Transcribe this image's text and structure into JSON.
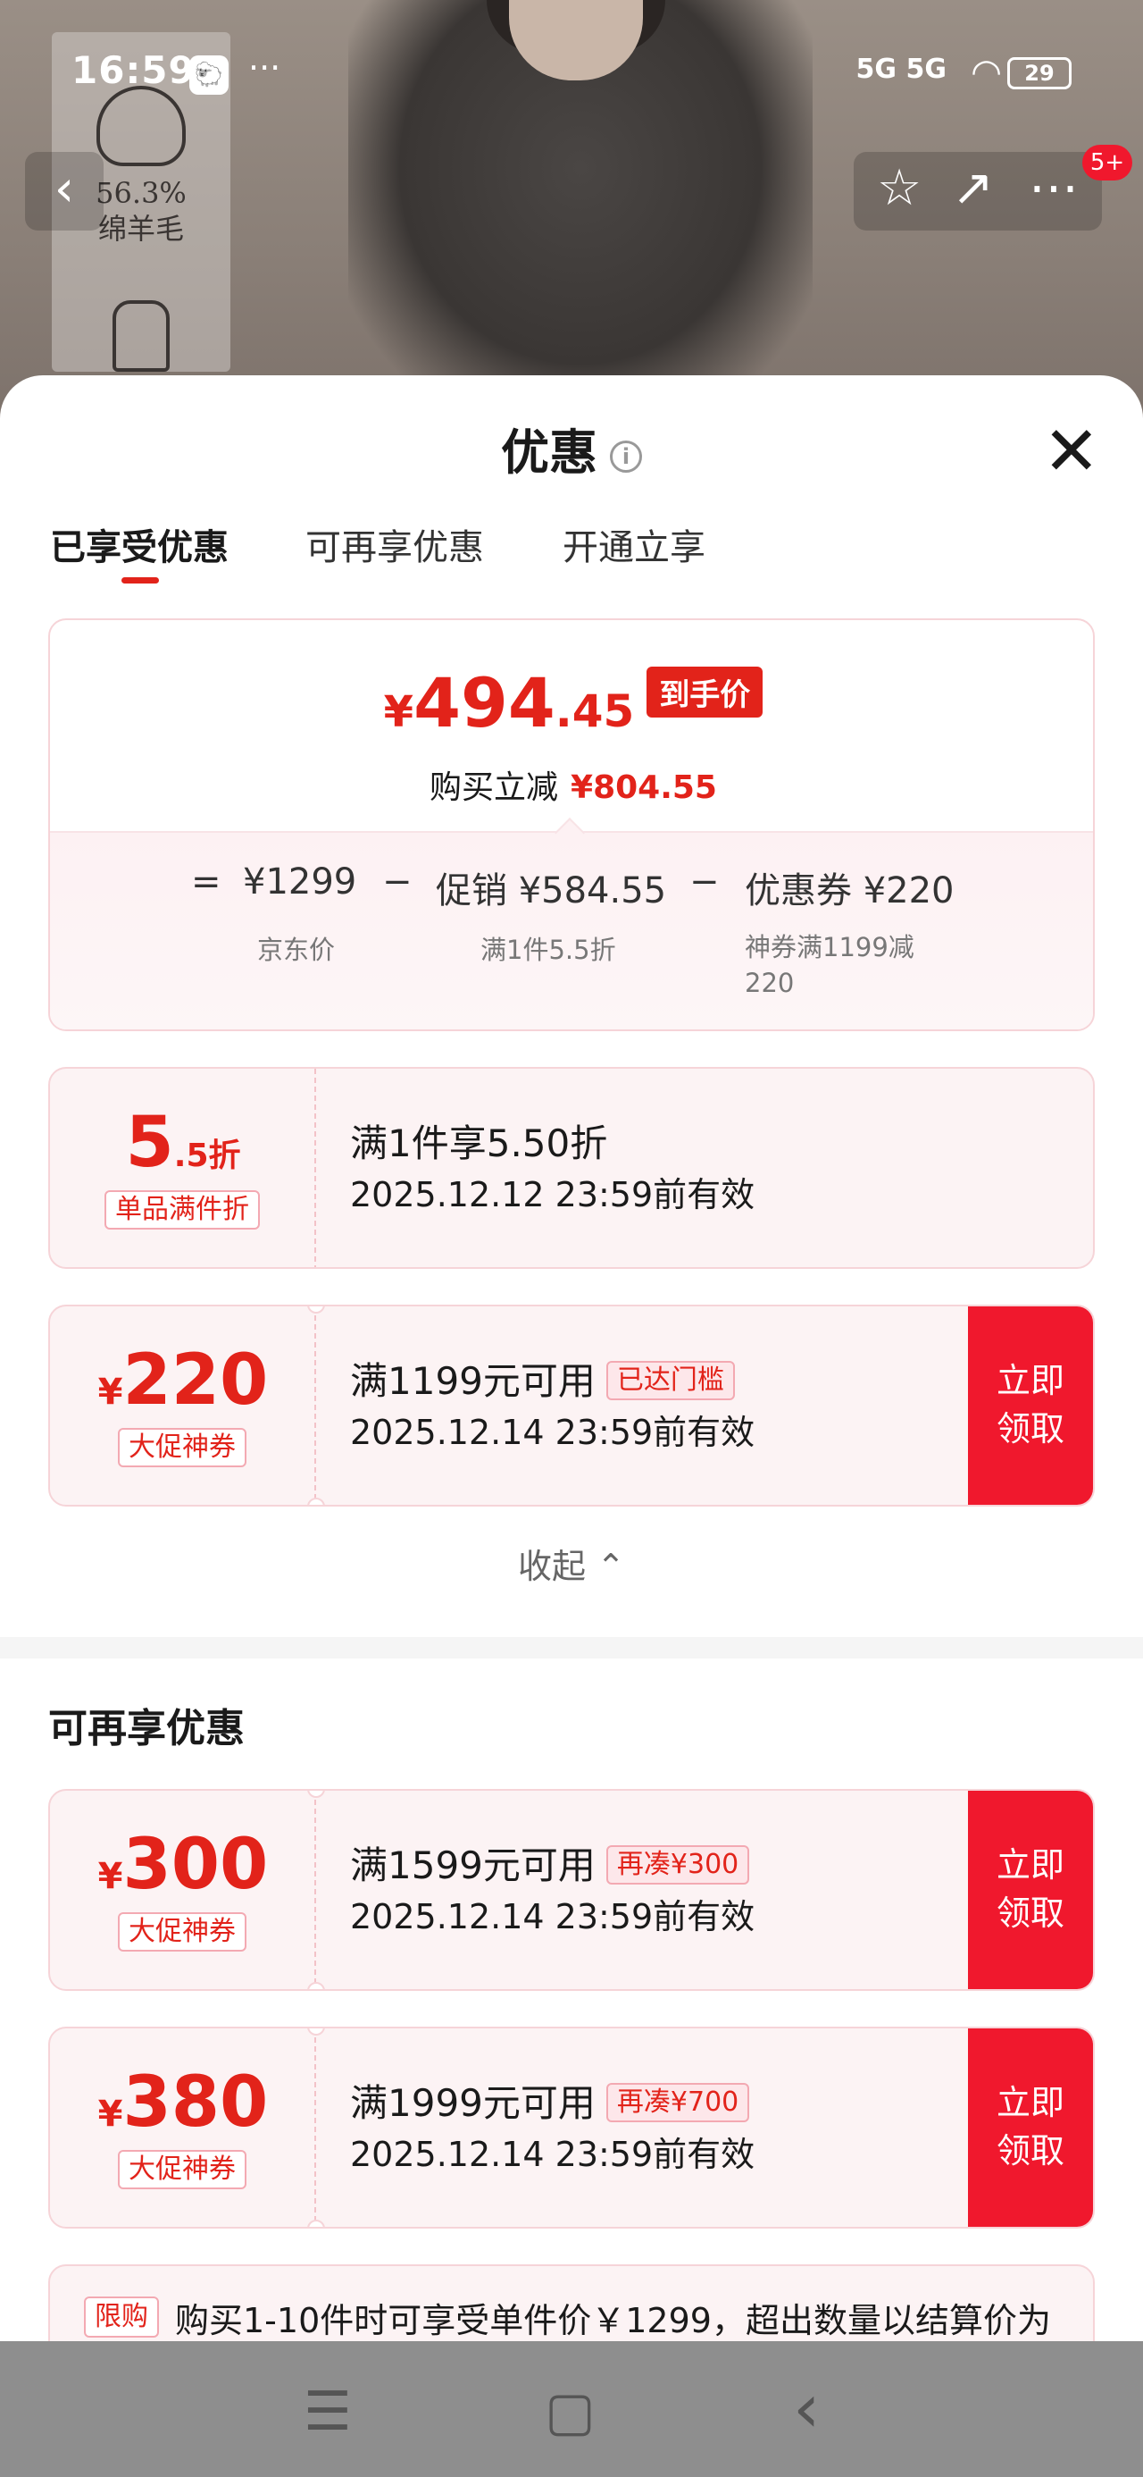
{
  "status_bar": {
    "time": "16:59",
    "app_badge": "🐑",
    "dots": "···",
    "network": "5G 5G",
    "battery": "29"
  },
  "background": {
    "fabric_label_1": "56.3%",
    "fabric_label_2": "绵羊毛"
  },
  "top_nav": {
    "back_icon": "chevron-left-icon",
    "badge": "5+"
  },
  "sheet": {
    "title": "优惠",
    "info_icon": "i",
    "close_icon": "✕"
  },
  "tabs": [
    {
      "label": "已享受优惠",
      "active": true
    },
    {
      "label": "可再享优惠",
      "active": false
    },
    {
      "label": "开通立享",
      "active": false
    }
  ],
  "summary": {
    "yen": "¥",
    "price_int": "494",
    "price_dec": ".45",
    "price_tag": "到手价",
    "reduce_label": "购买立减",
    "reduce_value": "¥804.55",
    "formula": {
      "eq": "=",
      "jd_price": "¥1299",
      "minus1": "−",
      "promo": "促销 ¥584.55",
      "minus2": "−",
      "coupon": "优惠券 ¥220"
    },
    "captions": {
      "jd_price": "京东价",
      "promo": "满1件5.5折",
      "coupon": "神券满1199减220"
    }
  },
  "coupons_enjoyed": [
    {
      "yen": "",
      "amount": "5",
      "suffix": ".5折",
      "kind": "单品满件折",
      "condition": "满1件享5.50折",
      "chip": "",
      "validity": "2025.12.12 23:59前有效",
      "claim": ""
    },
    {
      "yen": "¥",
      "amount": "220",
      "suffix": "",
      "kind": "大促神券",
      "condition": "满1199元可用",
      "chip": "已达门槛",
      "validity": "2025.12.14 23:59前有效",
      "claim": "立即领取"
    }
  ],
  "collapse_label": "收起 ⌃",
  "more_section": {
    "title": "可再享优惠",
    "coupons": [
      {
        "yen": "¥",
        "amount": "300",
        "kind": "大促神券",
        "condition": "满1599元可用",
        "chip": "再凑¥300",
        "validity": "2025.12.14 23:59前有效",
        "claim": "立即领取"
      },
      {
        "yen": "¥",
        "amount": "380",
        "kind": "大促神券",
        "condition": "满1999元可用",
        "chip": "再凑¥700",
        "validity": "2025.12.14 23:59前有效",
        "claim": "立即领取"
      }
    ]
  },
  "limit_notice": {
    "tag": "限购",
    "text": "购买1-10件时可享受单件价￥1299，超出数量以结算价为"
  },
  "nav_bar": {
    "menu": "☰",
    "home": "▢",
    "back": "‹"
  }
}
